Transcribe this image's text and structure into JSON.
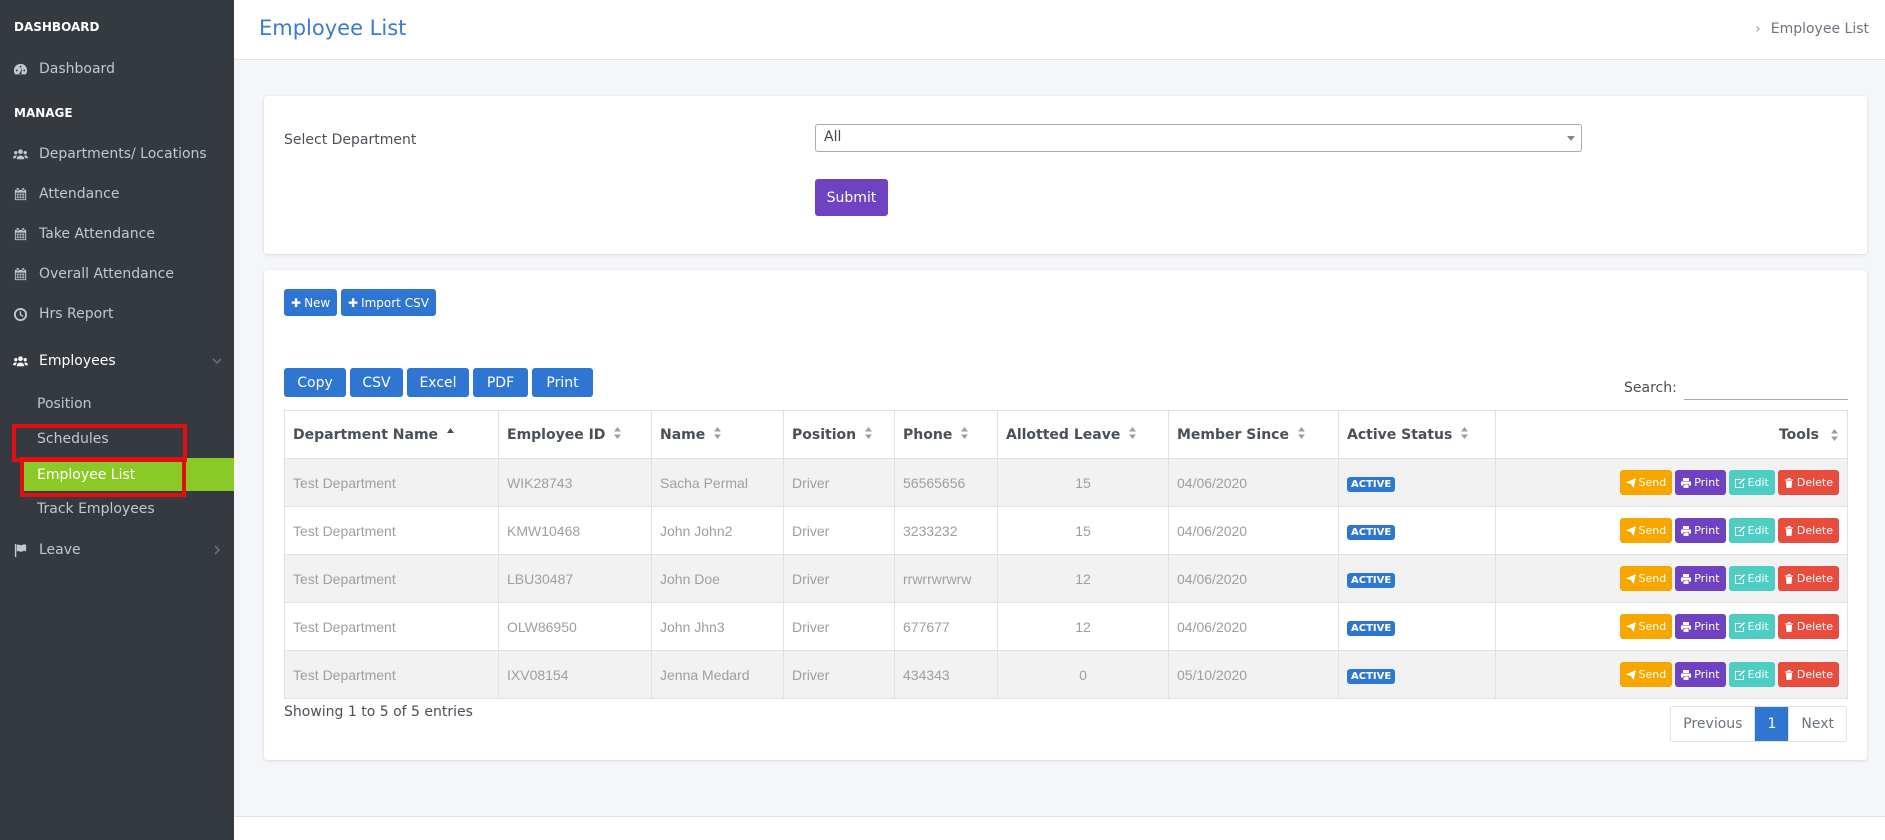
{
  "sidebar": {
    "heading_dashboard": "DASHBOARD",
    "heading_manage": "MANAGE",
    "items": [
      {
        "label": "Dashboard",
        "icon": "dashboard-icon"
      },
      {
        "label": "Departments/ Locations",
        "icon": "users-icon"
      },
      {
        "label": "Attendance",
        "icon": "calendar-icon"
      },
      {
        "label": "Take Attendance",
        "icon": "calendar-icon"
      },
      {
        "label": "Overall Attendance",
        "icon": "calendar-icon"
      },
      {
        "label": "Hrs Report",
        "icon": "clock-icon"
      },
      {
        "label": "Employees",
        "icon": "users-icon"
      },
      {
        "label": "Leave",
        "icon": "flag-icon"
      }
    ],
    "employees_sub": [
      {
        "label": "Position"
      },
      {
        "label": "Schedules"
      },
      {
        "label": "Employee List"
      },
      {
        "label": "Track Employees"
      }
    ]
  },
  "header": {
    "title": "Employee List",
    "breadcrumb": "Employee List"
  },
  "filter": {
    "label": "Select Department",
    "selected": "All",
    "submit_label": "Submit"
  },
  "actions": {
    "new_label": "New",
    "import_label": "Import CSV"
  },
  "exports": [
    "Copy",
    "CSV",
    "Excel",
    "PDF",
    "Print"
  ],
  "search": {
    "label": "Search:",
    "value": ""
  },
  "table": {
    "columns": [
      "Department Name",
      "Employee ID",
      "Name",
      "Position",
      "Phone",
      "Allotted Leave",
      "Member Since",
      "Active Status",
      "Tools"
    ],
    "rows": [
      [
        "Test Department",
        "WIK28743",
        "Sacha Permal",
        "Driver",
        "56565656",
        "15",
        "04/06/2020",
        "ACTIVE"
      ],
      [
        "Test Department",
        "KMW10468",
        "John John2",
        "Driver",
        "3233232",
        "15",
        "04/06/2020",
        "ACTIVE"
      ],
      [
        "Test Department",
        "LBU30487",
        "John Doe",
        "Driver",
        "rrwrrwrwrw",
        "12",
        "04/06/2020",
        "ACTIVE"
      ],
      [
        "Test Department",
        "OLW86950",
        "John Jhn3",
        "Driver",
        "677677",
        "12",
        "04/06/2020",
        "ACTIVE"
      ],
      [
        "Test Department",
        "IXV08154",
        "Jenna Medard",
        "Driver",
        "434343",
        "0",
        "05/10/2020",
        "ACTIVE"
      ]
    ],
    "tool_buttons": {
      "send": "Send",
      "print": "Print",
      "edit": "Edit",
      "delete": "Delete"
    }
  },
  "pagination": {
    "info": "Showing 1 to 5 of 5 entries",
    "previous": "Previous",
    "current": "1",
    "next": "Next"
  },
  "colors": {
    "sidebar_bg": "#343a40",
    "active_item": "#8ac926",
    "primary": "#2f76d2",
    "submit": "#6f42c1",
    "send": "#f7a600",
    "print": "#6f42c1",
    "edit": "#4ecdc4",
    "delete": "#e74c3c",
    "annotation": "#e01010"
  }
}
